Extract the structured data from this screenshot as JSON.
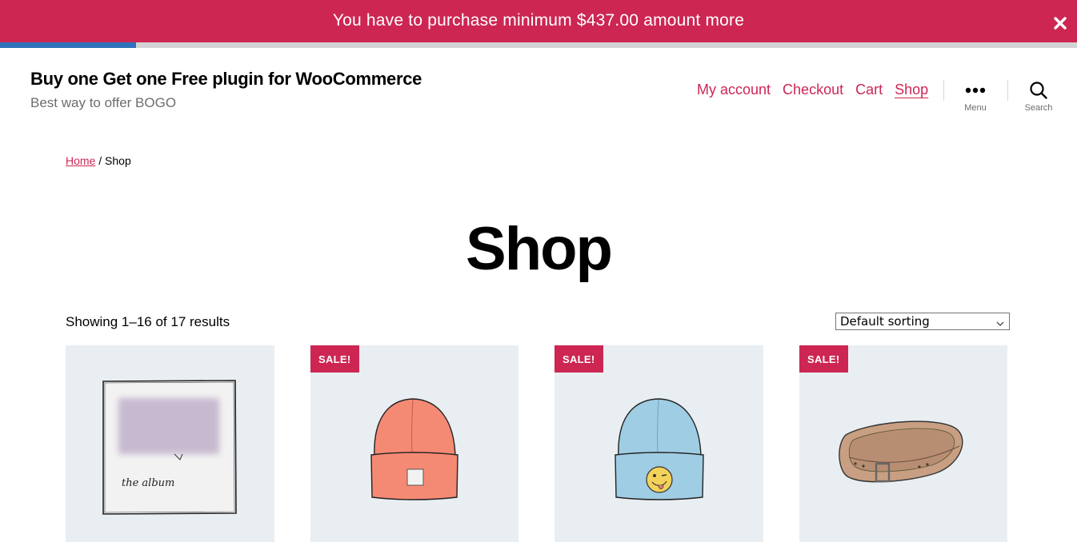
{
  "notice": {
    "text": "You have to purchase minimum $437.00 amount more",
    "progress_fraction": 0.126
  },
  "header": {
    "site_title": "Buy one Get one Free plugin for WooCommerce",
    "site_description": "Best way to offer BOGO",
    "nav": [
      {
        "label": "My account"
      },
      {
        "label": "Checkout"
      },
      {
        "label": "Cart"
      },
      {
        "label": "Shop",
        "current": true
      }
    ],
    "menu_label": "Menu",
    "search_label": "Search"
  },
  "breadcrumb": {
    "home": "Home",
    "separator": " / ",
    "current": "Shop"
  },
  "page_title": "Shop",
  "results": "Showing 1–16 of 17 results",
  "sorting": {
    "selected": "Default sorting"
  },
  "products": [
    {
      "image": "album-illustration",
      "album_text": "the album",
      "sale": false
    },
    {
      "image": "orange-beanie-illustration",
      "sale": true,
      "badge": "SALE!"
    },
    {
      "image": "blue-beanie-with-logo-illustration",
      "sale": true,
      "badge": "SALE!"
    },
    {
      "image": "belt-illustration",
      "sale": true,
      "badge": "SALE!"
    }
  ],
  "colors": {
    "accent": "#cd2653",
    "progress": "#2e72bb",
    "product_bg": "#e9eef2"
  }
}
